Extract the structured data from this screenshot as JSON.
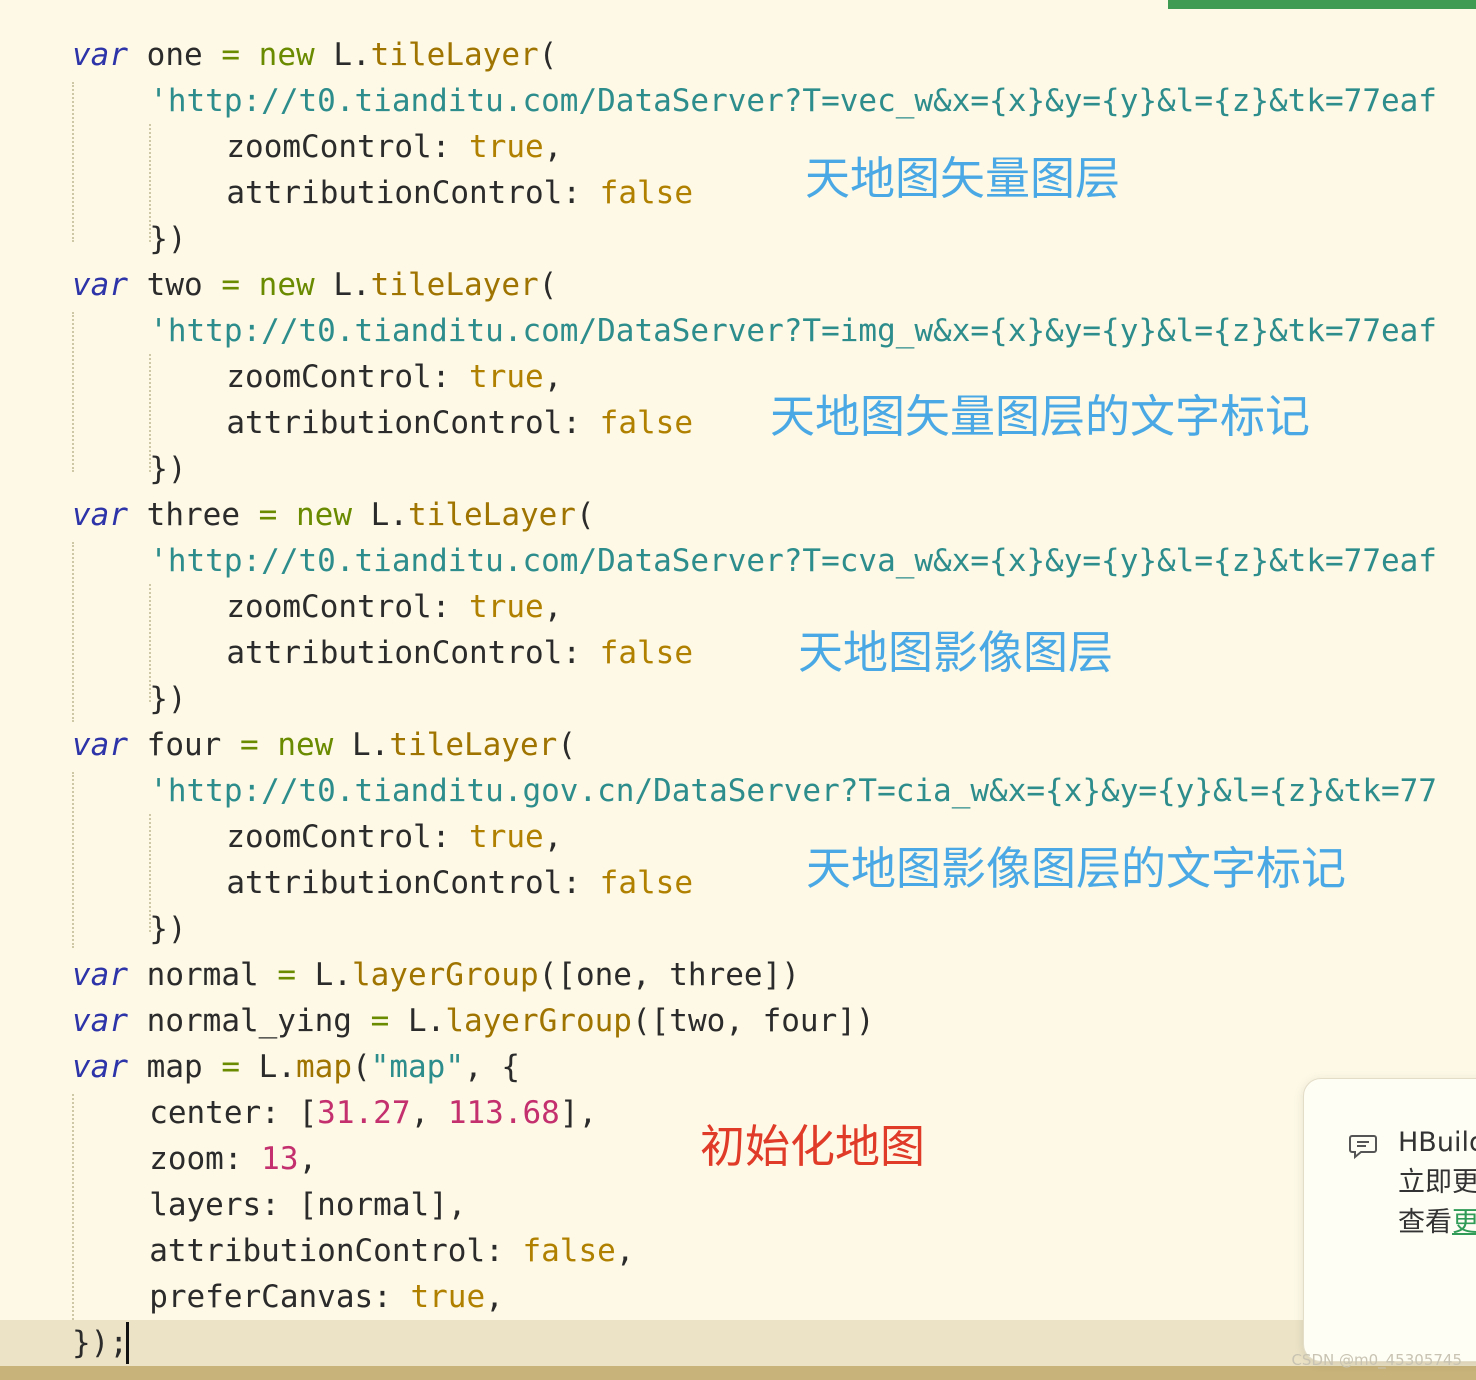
{
  "editor": {
    "lines": [
      {
        "indent": 4,
        "segments": [
          {
            "t": "var",
            "c": "kw"
          },
          {
            "t": " one ",
            "c": "id"
          },
          {
            "t": "=",
            "c": "op"
          },
          {
            "t": " ",
            "c": "id"
          },
          {
            "t": "new",
            "c": "new"
          },
          {
            "t": " L.",
            "c": "id"
          },
          {
            "t": "tileLayer",
            "c": "fn"
          },
          {
            "t": "(",
            "c": "id"
          }
        ]
      },
      {
        "indent": 8,
        "segments": [
          {
            "t": "'http://t0.tianditu.com/DataServer?T=vec_w&x={x}&y={y}&l={z}&tk=77eaf",
            "c": "str"
          }
        ]
      },
      {
        "indent": 12,
        "segments": [
          {
            "t": "zoomControl: ",
            "c": "id"
          },
          {
            "t": "true",
            "c": "bool"
          },
          {
            "t": ",",
            "c": "id"
          }
        ]
      },
      {
        "indent": 12,
        "segments": [
          {
            "t": "attributionControl: ",
            "c": "id"
          },
          {
            "t": "false",
            "c": "bool"
          }
        ]
      },
      {
        "indent": 8,
        "segments": [
          {
            "t": "})",
            "c": "id"
          }
        ]
      },
      {
        "indent": 4,
        "segments": [
          {
            "t": "var",
            "c": "kw"
          },
          {
            "t": " two ",
            "c": "id"
          },
          {
            "t": "=",
            "c": "op"
          },
          {
            "t": " ",
            "c": "id"
          },
          {
            "t": "new",
            "c": "new"
          },
          {
            "t": " L.",
            "c": "id"
          },
          {
            "t": "tileLayer",
            "c": "fn"
          },
          {
            "t": "(",
            "c": "id"
          }
        ]
      },
      {
        "indent": 8,
        "segments": [
          {
            "t": "'http://t0.tianditu.com/DataServer?T=img_w&x={x}&y={y}&l={z}&tk=77eaf",
            "c": "str"
          }
        ]
      },
      {
        "indent": 12,
        "segments": [
          {
            "t": "zoomControl: ",
            "c": "id"
          },
          {
            "t": "true",
            "c": "bool"
          },
          {
            "t": ",",
            "c": "id"
          }
        ]
      },
      {
        "indent": 12,
        "segments": [
          {
            "t": "attributionControl: ",
            "c": "id"
          },
          {
            "t": "false",
            "c": "bool"
          }
        ]
      },
      {
        "indent": 8,
        "segments": [
          {
            "t": "})",
            "c": "id"
          }
        ]
      },
      {
        "indent": 4,
        "segments": [
          {
            "t": "var",
            "c": "kw"
          },
          {
            "t": " three ",
            "c": "id"
          },
          {
            "t": "=",
            "c": "op"
          },
          {
            "t": " ",
            "c": "id"
          },
          {
            "t": "new",
            "c": "new"
          },
          {
            "t": " L.",
            "c": "id"
          },
          {
            "t": "tileLayer",
            "c": "fn"
          },
          {
            "t": "(",
            "c": "id"
          }
        ]
      },
      {
        "indent": 8,
        "segments": [
          {
            "t": "'http://t0.tianditu.com/DataServer?T=cva_w&x={x}&y={y}&l={z}&tk=77eaf",
            "c": "str"
          }
        ]
      },
      {
        "indent": 12,
        "segments": [
          {
            "t": "zoomControl: ",
            "c": "id"
          },
          {
            "t": "true",
            "c": "bool"
          },
          {
            "t": ",",
            "c": "id"
          }
        ]
      },
      {
        "indent": 12,
        "segments": [
          {
            "t": "attributionControl: ",
            "c": "id"
          },
          {
            "t": "false",
            "c": "bool"
          }
        ]
      },
      {
        "indent": 8,
        "segments": [
          {
            "t": "})",
            "c": "id"
          }
        ]
      },
      {
        "indent": 4,
        "segments": [
          {
            "t": "var",
            "c": "kw"
          },
          {
            "t": " four ",
            "c": "id"
          },
          {
            "t": "=",
            "c": "op"
          },
          {
            "t": " ",
            "c": "id"
          },
          {
            "t": "new",
            "c": "new"
          },
          {
            "t": " L.",
            "c": "id"
          },
          {
            "t": "tileLayer",
            "c": "fn"
          },
          {
            "t": "(",
            "c": "id"
          }
        ]
      },
      {
        "indent": 8,
        "segments": [
          {
            "t": "'http://t0.tianditu.gov.cn/DataServer?T=cia_w&x={x}&y={y}&l={z}&tk=77",
            "c": "str"
          }
        ]
      },
      {
        "indent": 12,
        "segments": [
          {
            "t": "zoomControl: ",
            "c": "id"
          },
          {
            "t": "true",
            "c": "bool"
          },
          {
            "t": ",",
            "c": "id"
          }
        ]
      },
      {
        "indent": 12,
        "segments": [
          {
            "t": "attributionControl: ",
            "c": "id"
          },
          {
            "t": "false",
            "c": "bool"
          }
        ]
      },
      {
        "indent": 8,
        "segments": [
          {
            "t": "})",
            "c": "id"
          }
        ]
      },
      {
        "indent": 4,
        "segments": [
          {
            "t": "var",
            "c": "kw"
          },
          {
            "t": " normal ",
            "c": "id"
          },
          {
            "t": "=",
            "c": "op"
          },
          {
            "t": " L.",
            "c": "id"
          },
          {
            "t": "layerGroup",
            "c": "fn"
          },
          {
            "t": "([one, three])",
            "c": "id"
          }
        ]
      },
      {
        "indent": 4,
        "segments": [
          {
            "t": "var",
            "c": "kw"
          },
          {
            "t": " normal_ying ",
            "c": "id"
          },
          {
            "t": "=",
            "c": "op"
          },
          {
            "t": " L.",
            "c": "id"
          },
          {
            "t": "layerGroup",
            "c": "fn"
          },
          {
            "t": "([two, four])",
            "c": "id"
          }
        ]
      },
      {
        "indent": 4,
        "segments": [
          {
            "t": "var",
            "c": "kw"
          },
          {
            "t": " map ",
            "c": "id"
          },
          {
            "t": "=",
            "c": "op"
          },
          {
            "t": " L.",
            "c": "id"
          },
          {
            "t": "map",
            "c": "fn"
          },
          {
            "t": "(",
            "c": "id"
          },
          {
            "t": "\"map\"",
            "c": "str"
          },
          {
            "t": ", {",
            "c": "id"
          }
        ]
      },
      {
        "indent": 8,
        "segments": [
          {
            "t": "center: [",
            "c": "id"
          },
          {
            "t": "31.27",
            "c": "num"
          },
          {
            "t": ", ",
            "c": "id"
          },
          {
            "t": "113.68",
            "c": "num"
          },
          {
            "t": "],",
            "c": "id"
          }
        ]
      },
      {
        "indent": 8,
        "segments": [
          {
            "t": "zoom: ",
            "c": "id"
          },
          {
            "t": "13",
            "c": "num"
          },
          {
            "t": ",",
            "c": "id"
          }
        ]
      },
      {
        "indent": 8,
        "segments": [
          {
            "t": "layers: [normal],",
            "c": "id"
          }
        ]
      },
      {
        "indent": 8,
        "segments": [
          {
            "t": "attributionControl: ",
            "c": "id"
          },
          {
            "t": "false",
            "c": "bool"
          },
          {
            "t": ",",
            "c": "id"
          }
        ]
      },
      {
        "indent": 8,
        "segments": [
          {
            "t": "preferCanvas: ",
            "c": "id"
          },
          {
            "t": "true",
            "c": "bool"
          },
          {
            "t": ",",
            "c": "id"
          }
        ]
      },
      {
        "indent": 4,
        "current": true,
        "segments": [
          {
            "t": "});",
            "c": "id"
          }
        ]
      }
    ]
  },
  "annotations": {
    "vec_layer": "天地图矢量图层",
    "vec_labels": "天地图矢量图层的文字标记",
    "img_layer": "天地图影像图层",
    "img_labels": "天地图影像图层的文字标记",
    "init_map": "初始化地图"
  },
  "toast": {
    "icon": "message-icon",
    "title": "HBuild",
    "line1": "立即更",
    "line2_prefix": "查看",
    "line2_link": "更"
  },
  "watermark": "CSDN @m0_45305745",
  "colors": {
    "background": "#fdf9e6",
    "keyword": "#2d33a8",
    "function": "#a07400",
    "string": "#2d8c8c",
    "boolean": "#b08000",
    "number": "#c4306e",
    "annotation_blue": "#4aa9e4",
    "annotation_red": "#e03a28",
    "toast_link": "#2f9b56"
  }
}
